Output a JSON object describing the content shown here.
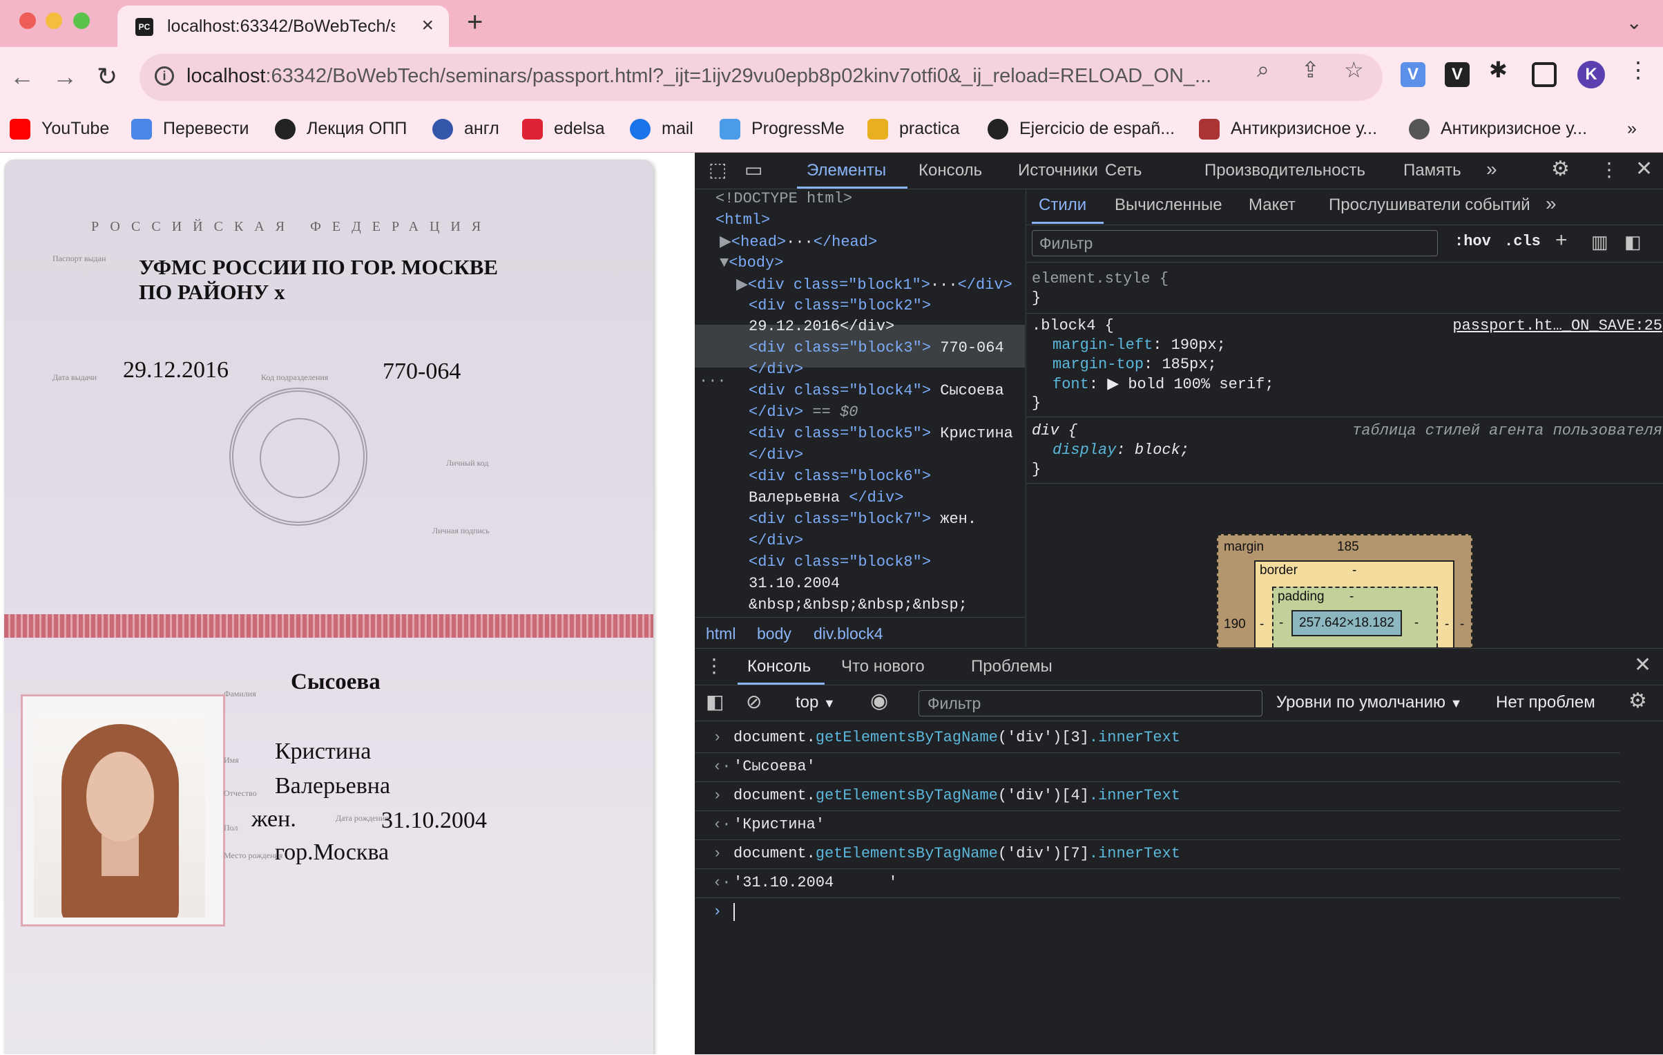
{
  "browser": {
    "tab_title": "localhost:63342/BoWebTech/s",
    "favicon_text": "PC",
    "url_host": "localhost",
    "url_rest": ":63342/BoWebTech/seminars/passport.html?_ijt=1ijv29vu0epb8p02kinv7otfi0&_ij_reload=RELOAD_ON_...",
    "profile_initial": "K",
    "bookmarks": [
      "YouTube",
      "Перевести",
      "Лекция ОПП",
      "англ",
      "edelsa",
      "mail",
      "ProgressMe",
      "practica",
      "Ejercicio de españ...",
      "Антикризисное у...",
      "Антикризисное у..."
    ],
    "bookmarks_more": "»"
  },
  "passport": {
    "header": "РОССИЙСКАЯ ФЕДЕРАЦИЯ",
    "issued_by_line1": "УФМС РОССИИ ПО ГОР. МОСКВЕ",
    "issued_by_line2": "ПО РАЙОНУ х",
    "issue_date": "29.12.2016",
    "dept_code": "770-064",
    "surname": "Сысоева",
    "name": "Кристина",
    "patronymic": "Валерьевна",
    "sex": "жен.",
    "birth_date": "31.10.2004",
    "birth_place": "гор.Москва"
  },
  "devtools": {
    "main_tabs": [
      "Элементы",
      "Консоль",
      "Источники",
      "Сеть",
      "Производительность",
      "Память"
    ],
    "active_tab": "Элементы",
    "more": "»",
    "elements": {
      "doctype": "<!DOCTYPE html>",
      "html_open": "<html>",
      "head": "<head>",
      "head_close": "</head>",
      "body": "<body>",
      "b1_open": "<div class=\"block1\">",
      "b1_close": "</div>",
      "b2_open": "<div class=\"block2\">",
      "b2_text": "29.12.2016</div>",
      "b3_open": "<div class=\"block3\">",
      "b3_text": "770-064",
      "b3_close": "</div>",
      "b4_open": "<div class=\"block4\">",
      "b4_text": "Сысоева",
      "b4_close": "</div>",
      "b4_eq": "== $0",
      "b5_open": "<div class=\"block5\">",
      "b5_text": "Кристина",
      "b5_close": "</div>",
      "b6_open": "<div class=\"block6\">",
      "b6_text": "Валерьевна",
      "b6_close": "</div>",
      "b7_open": "<div class=\"block7\">",
      "b7_text": "жен.",
      "b7_close": "</div>",
      "b8_open": "<div class=\"block8\">",
      "b8_text": "31.10.2004",
      "b8_nbsp": "&nbsp;&nbsp;&nbsp;&nbsp;",
      "dots": "···",
      "ellipsis": "···"
    },
    "breadcrumbs": [
      "html",
      "body",
      "div.block4"
    ],
    "styles": {
      "tabs": [
        "Стили",
        "Вычисленные",
        "Макет",
        "Прослушиватели событий"
      ],
      "more": "»",
      "filter_placeholder": "Фильтр",
      "hov": ":hov",
      "cls": ".cls",
      "element_style": "element.style {",
      "close_brace": "}",
      "block4_selector": ".block4 {",
      "block4_source": "passport.ht…_ON_SAVE:25",
      "props": [
        {
          "name": "margin-left",
          "value": "190px;"
        },
        {
          "name": "margin-top",
          "value": "185px;"
        },
        {
          "name": "font",
          "value": "▶ bold 100% serif;"
        }
      ],
      "div_selector": "div {",
      "div_source": "таблица стилей агента пользователя",
      "div_prop": {
        "name": "display",
        "value": "block;"
      }
    },
    "box_model": {
      "margin_label": "margin",
      "margin_top": "185",
      "margin_left": "190",
      "border_label": "border",
      "border_val": "-",
      "padding_label": "padding",
      "padding_val": "-",
      "content": "257.642×18.182",
      "dash": "-"
    },
    "console": {
      "tabs": [
        "Консоль",
        "Что нового",
        "Проблемы"
      ],
      "context": "top",
      "filter_placeholder": "Фильтр",
      "levels": "Уровни по умолчанию",
      "issues": "Нет проблем",
      "rows": [
        {
          "type": "in",
          "prefix": "document.",
          "fn": "getElementsByTagName",
          "args": "('div')",
          "idx": "[3]",
          "prop": ".innerText"
        },
        {
          "type": "out",
          "value": "'Сысоева'"
        },
        {
          "type": "in",
          "prefix": "document.",
          "fn": "getElementsByTagName",
          "args": "('div')",
          "idx": "[4]",
          "prop": ".innerText"
        },
        {
          "type": "out",
          "value": "'Кристина'"
        },
        {
          "type": "in",
          "prefix": "document.",
          "fn": "getElementsByTagName",
          "args": "('div')",
          "idx": "[7]",
          "prop": ".innerText"
        },
        {
          "type": "out",
          "value": "'31.10.2004      '"
        }
      ]
    }
  },
  "colors": {
    "tabstrip": "#f2b6c6",
    "toolbar": "#fce8ee",
    "devtools_bg": "#202124",
    "accent": "#8ab4f8",
    "passport_red": "#c96b77"
  }
}
